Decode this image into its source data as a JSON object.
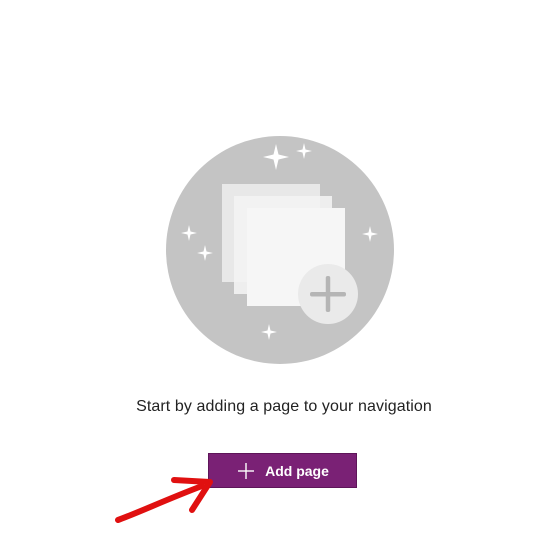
{
  "empty_state": {
    "message": "Start by adding a page to your navigation",
    "illustration_icon": "pages-add-illustration-icon",
    "illustration_bg_color": "#c4c4c4"
  },
  "add_button": {
    "label": "Add page",
    "icon": "plus-icon",
    "bg_color": "#7a2175"
  },
  "annotation": {
    "icon": "red-arrow-icon",
    "color": "#e01010"
  }
}
